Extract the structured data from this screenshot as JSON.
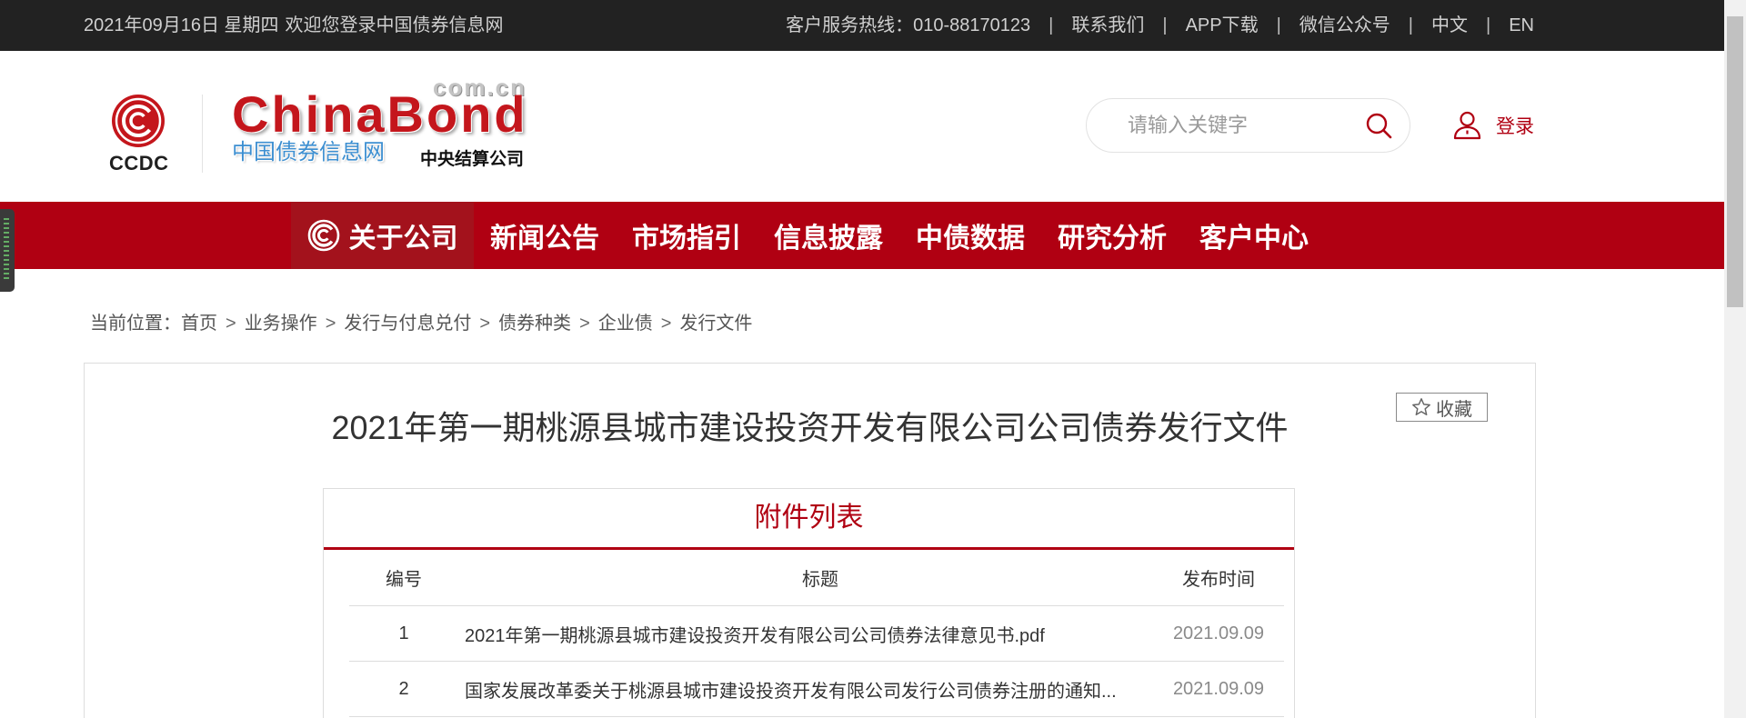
{
  "colors": {
    "brand_red": "#b00012",
    "nav_active_bg": "#a3121c",
    "topbar_bg": "#222222",
    "brand_blue": "#3d8fd1"
  },
  "topbar": {
    "date": "2021年09月16日 星期四",
    "welcome": "欢迎您登录中国债券信息网",
    "hotline_label": "客户服务热线：",
    "hotline": "010-88170123",
    "separator": "|",
    "links": [
      "联系我们",
      "APP下载",
      "微信公众号",
      "中文",
      "EN"
    ]
  },
  "header": {
    "logo": {
      "ccdc": "CCDC",
      "brand": "ChinaBond",
      "domain": "com.cn",
      "site_name": "中国债券信息网",
      "company": "中央结算公司"
    },
    "search": {
      "placeholder": "请输入关键字",
      "icon": "search-icon"
    },
    "login": {
      "label": "登录",
      "icon": "user-icon"
    }
  },
  "nav": {
    "items": [
      {
        "label": "关于公司",
        "active": true,
        "icon": "ccdc-mark-icon"
      },
      {
        "label": "新闻公告"
      },
      {
        "label": "市场指引"
      },
      {
        "label": "信息披露"
      },
      {
        "label": "中债数据"
      },
      {
        "label": "研究分析"
      },
      {
        "label": "客户中心"
      }
    ]
  },
  "breadcrumb": {
    "prefix": "当前位置：",
    "separator": ">",
    "items": [
      "首页",
      "业务操作",
      "发行与付息兑付",
      "债券种类",
      "企业债",
      "发行文件"
    ]
  },
  "article": {
    "title": "2021年第一期桃源县城市建设投资开发有限公司公司债券发行文件",
    "favorite_label": "收藏",
    "favorite_icon": "star-icon"
  },
  "attachments": {
    "heading": "附件列表",
    "columns": [
      "编号",
      "标题",
      "发布时间"
    ],
    "rows": [
      {
        "no": "1",
        "title": "2021年第一期桃源县城市建设投资开发有限公司公司债券法律意见书.pdf",
        "date": "2021.09.09"
      },
      {
        "no": "2",
        "title": "国家发展改革委关于桃源县城市建设投资开发有限公司发行公司债券注册的通知...",
        "date": "2021.09.09"
      }
    ]
  }
}
